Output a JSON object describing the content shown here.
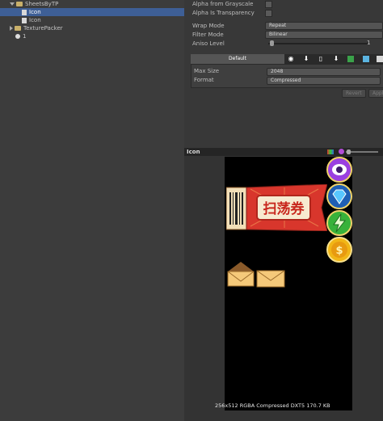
{
  "project": {
    "items": [
      {
        "label": "SheetsByTP",
        "kind": "folder",
        "indent": 1,
        "expanded": true,
        "selected": false
      },
      {
        "label": "Icon",
        "kind": "file",
        "indent": 2,
        "selected": true
      },
      {
        "label": "Icon",
        "kind": "file",
        "indent": 2,
        "selected": false
      },
      {
        "label": "TexturePacker",
        "kind": "folder",
        "indent": 1,
        "expanded": false,
        "selected": false
      },
      {
        "label": "1",
        "kind": "unity-scene",
        "indent": 1,
        "selected": false
      }
    ]
  },
  "inspector": {
    "alpha_from_grayscale_label": "Alpha from Grayscale",
    "alpha_is_transparency_label": "Alpha Is Transparency",
    "wrap_mode_label": "Wrap Mode",
    "wrap_mode_value": "Repeat",
    "filter_mode_label": "Filter Mode",
    "filter_mode_value": "Bilinear",
    "aniso_level_label": "Aniso Level",
    "aniso_level_value": "1",
    "platform_default_tab": "Default",
    "max_size_label": "Max Size",
    "max_size_value": "2048",
    "format_label": "Format",
    "format_value": "Compressed",
    "revert_label": "Revert",
    "apply_label": "Apply"
  },
  "preview": {
    "title": "Icon",
    "banner_text": "扫荡券",
    "caption": "256x512  RGBA Compressed DXT5  170.7 KB"
  },
  "colors": {
    "selection": "#3e5f96",
    "banner_red": "#d8362c",
    "banner_cream": "#f2dfb8",
    "gem_blue": "#2f8fe6",
    "bolt_green": "#38b23a",
    "coin_gold": "#f1b616",
    "eye_purple": "#9a3fe0"
  }
}
